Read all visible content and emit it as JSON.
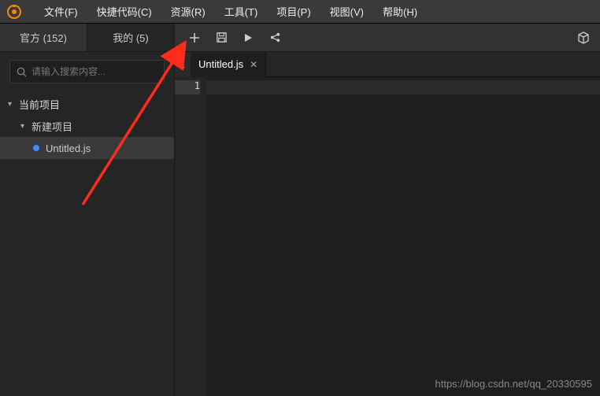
{
  "menubar": {
    "items": [
      "文件(F)",
      "快捷代码(C)",
      "资源(R)",
      "工具(T)",
      "项目(P)",
      "视图(V)",
      "帮助(H)"
    ]
  },
  "sidebar_tabs": {
    "official": "官方 (152)",
    "mine": "我的 (5)"
  },
  "search": {
    "placeholder": "请输入搜索内容..."
  },
  "tree": {
    "root_label": "当前项目",
    "project_label": "新建项目",
    "file_label": "Untitled.js"
  },
  "editor": {
    "tab_label": "Untitled.js",
    "line_number": "1"
  },
  "watermark": "https://blog.csdn.net/qq_20330595",
  "colors": {
    "accent": "#ff8a00",
    "file_dot": "#3b8cff",
    "arrow": "#ff2b1c"
  }
}
